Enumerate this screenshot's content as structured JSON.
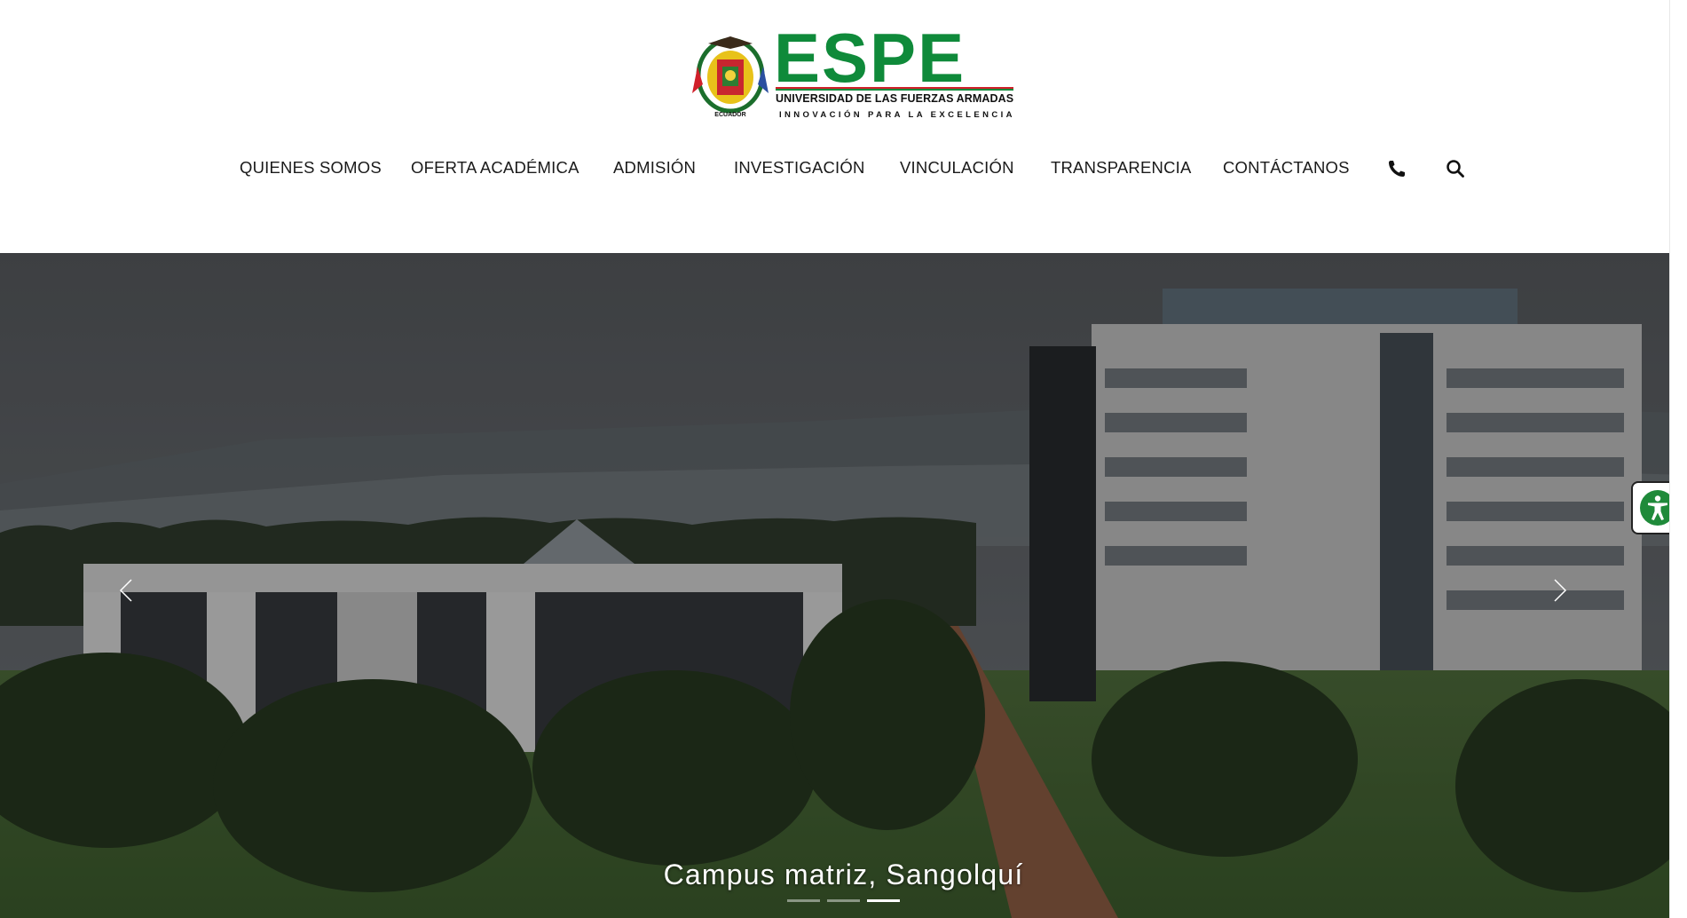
{
  "logo": {
    "wordmark": "ESPE",
    "subtitle": "UNIVERSIDAD DE LAS FUERZAS ARMADAS",
    "tagline": "INNOVACIÓN PARA LA EXCELENCIA",
    "crest_text": "ECUADOR",
    "brand_green": "#0f8a3a",
    "brand_red": "#d0202a"
  },
  "nav": {
    "items": [
      {
        "label": "QUIENES SOMOS"
      },
      {
        "label": "OFERTA ACADÉMICA"
      },
      {
        "label": "ADMISIÓN"
      },
      {
        "label": "INVESTIGACIÓN"
      },
      {
        "label": "VINCULACIÓN"
      },
      {
        "label": "TRANSPARENCIA"
      },
      {
        "label": "CONTÁCTANOS"
      }
    ],
    "icons": [
      "phone-icon",
      "search-icon"
    ]
  },
  "hero": {
    "caption": "Campus matriz, Sangolquí",
    "slide_count": 3,
    "active_slide": 3
  },
  "accessibility": {
    "icon": "accessibility-icon",
    "accent": "#1f8a3a"
  }
}
